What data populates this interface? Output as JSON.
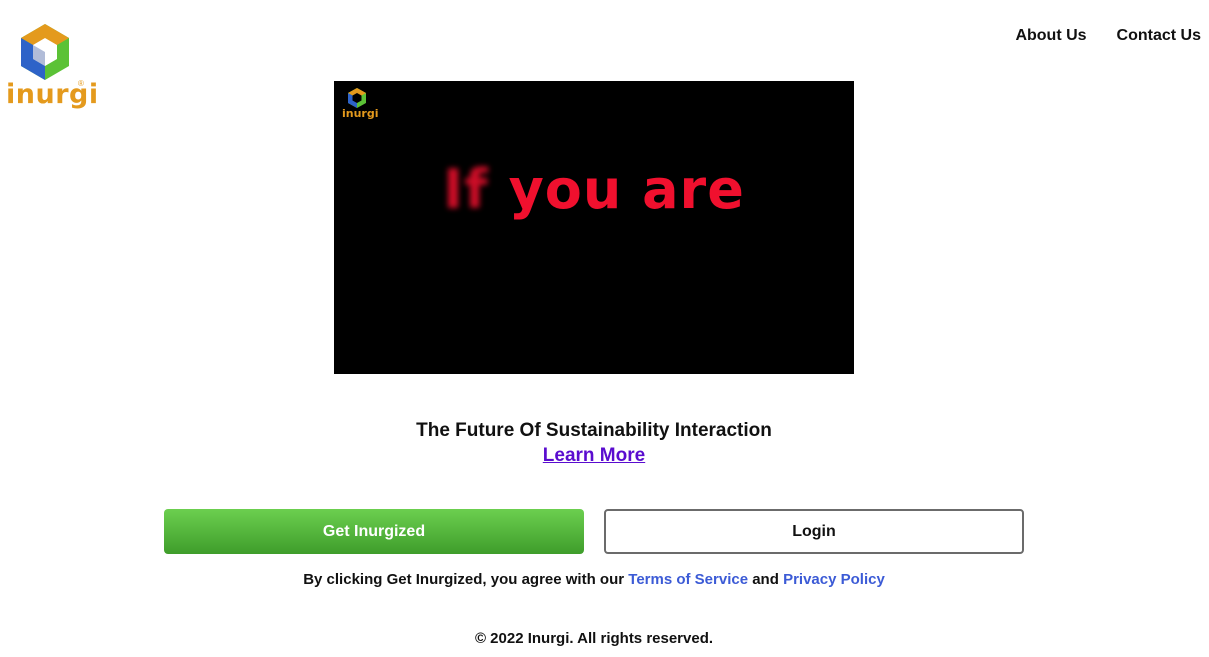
{
  "brand": {
    "logo_text": "inurgi",
    "registered_mark": "®",
    "colors": {
      "orange": "#e49a1d",
      "green": "#5bc236",
      "blue": "#2e63c8",
      "navy": "#1f3f8f"
    }
  },
  "nav": {
    "items": [
      {
        "label": "About Us"
      },
      {
        "label": "Contact Us"
      }
    ]
  },
  "video": {
    "logo_text": "inurgi",
    "caption_blurred": "If",
    "caption_sharp": "you are",
    "caption_color": "#f0102e"
  },
  "hero": {
    "tagline": "The Future Of Sustainability Interaction",
    "learn_more": "Learn More"
  },
  "actions": {
    "primary_label": "Get Inurgized",
    "secondary_label": "Login",
    "primary_color": "#4cae36"
  },
  "agreement": {
    "prefix": "By clicking Get Inurgized, you agree with our",
    "terms": "Terms of Service",
    "and": "and",
    "privacy": "Privacy Policy"
  },
  "footer": {
    "copyright": "© 2022 Inurgi. All rights reserved."
  }
}
